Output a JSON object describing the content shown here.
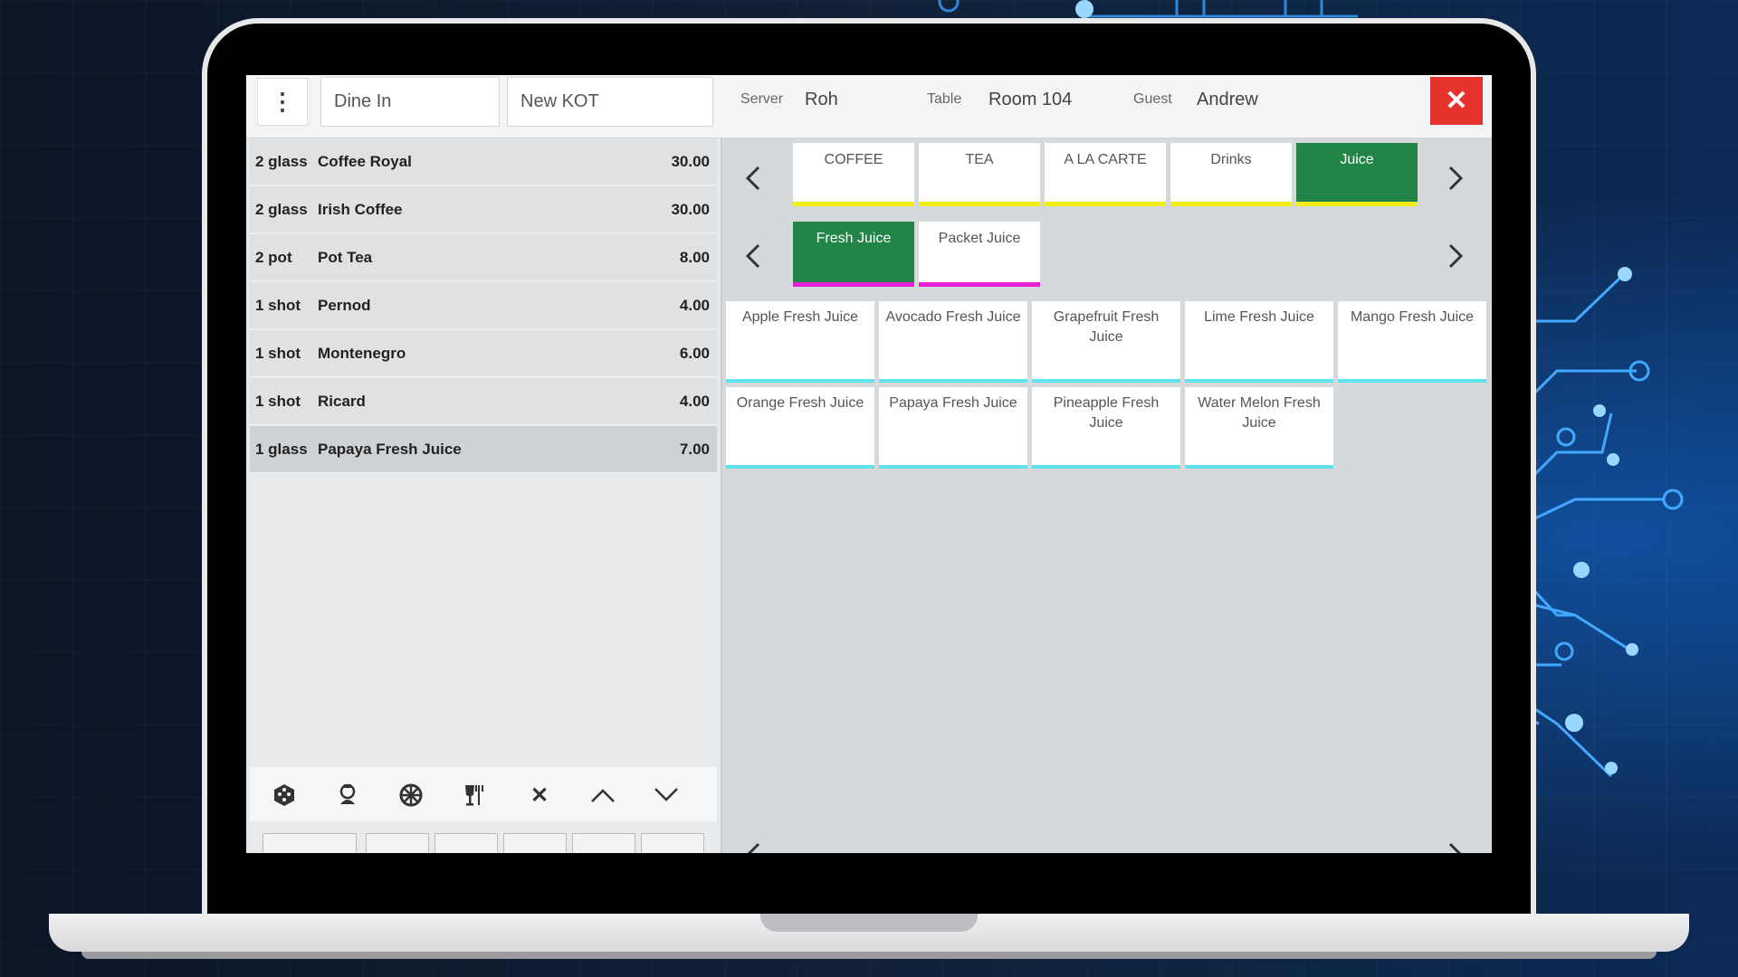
{
  "header": {
    "order_type": "Dine In",
    "kot": "New KOT",
    "server_label": "Server",
    "server_value": "Roh",
    "table_label": "Table",
    "table_value": "Room 104",
    "guest_label": "Guest",
    "guest_value": "Andrew",
    "close_label": "✕"
  },
  "order_items": [
    {
      "qty": "2 glass",
      "name": "Coffee Royal",
      "price": "30.00"
    },
    {
      "qty": "2 glass",
      "name": "Irish Coffee",
      "price": "30.00"
    },
    {
      "qty": "2 pot",
      "name": "Pot Tea",
      "price": "8.00"
    },
    {
      "qty": "1 shot",
      "name": "Pernod",
      "price": "4.00"
    },
    {
      "qty": "1 shot",
      "name": "Montenegro",
      "price": "6.00"
    },
    {
      "qty": "1 shot",
      "name": "Ricard",
      "price": "4.00"
    },
    {
      "qty": "1 glass",
      "name": "Papaya Fresh Juice",
      "price": "7.00",
      "selected": true
    }
  ],
  "toolbar_icons": [
    "dice-icon",
    "chef-icon",
    "wheel-icon",
    "dining-icon",
    "delete-icon",
    "chevron-up-icon",
    "chevron-down-icon"
  ],
  "categories": [
    {
      "label": "COFFEE"
    },
    {
      "label": "TEA"
    },
    {
      "label": "A LA CARTE"
    },
    {
      "label": "Drinks"
    },
    {
      "label": "Juice",
      "active": true
    }
  ],
  "subcategories": [
    {
      "label": "Fresh Juice",
      "active": true
    },
    {
      "label": "Packet Juice"
    }
  ],
  "menu_items": [
    "Apple Fresh Juice",
    "Avocado Fresh Juice",
    "Grapefruit Fresh Juice",
    "Lime Fresh Juice",
    "Mango Fresh Juice",
    "Orange Fresh Juice",
    "Papaya Fresh Juice",
    "Pineapple Fresh Juice",
    "Water Melon Fresh Juice"
  ],
  "colors": {
    "active_green": "#238447",
    "close_red": "#e5322d",
    "category_underline": "#f2ec17",
    "subcategory_underline": "#e71fd3",
    "item_underline": "#5ee3ee"
  }
}
